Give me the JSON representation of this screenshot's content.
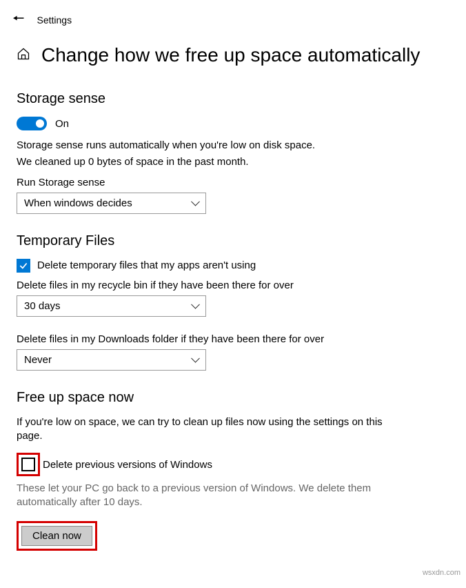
{
  "topbar": {
    "title": "Settings"
  },
  "header": {
    "page_title": "Change how we free up space automatically"
  },
  "storage_sense": {
    "heading": "Storage sense",
    "toggle_label": "On",
    "desc_line1": "Storage sense runs automatically when you're low on disk space.",
    "desc_line2": "We cleaned up 0 bytes of space in the past month.",
    "run_label": "Run Storage sense",
    "run_value": "When windows decides"
  },
  "temporary_files": {
    "heading": "Temporary Files",
    "delete_temp_label": "Delete temporary files that my apps aren't using",
    "recycle_label": "Delete files in my recycle bin if they have been there for over",
    "recycle_value": "30 days",
    "downloads_label": "Delete files in my Downloads folder if they have been there for over",
    "downloads_value": "Never"
  },
  "free_up": {
    "heading": "Free up space now",
    "intro": "If you're low on space, we can try to clean up files now using the settings on this page.",
    "delete_prev_label": "Delete previous versions of Windows",
    "muted": "These let your PC go back to a previous version of Windows. We delete them automatically after 10 days.",
    "clean_button": "Clean now"
  },
  "watermark": "wsxdn.com"
}
